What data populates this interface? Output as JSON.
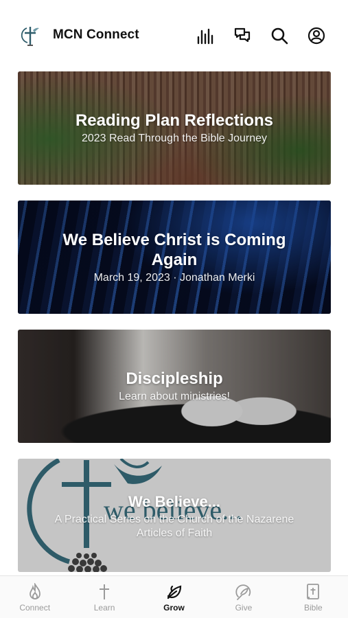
{
  "app": {
    "title": "MCN Connect"
  },
  "header_icons": [
    "bar-chart-icon",
    "chat-bubbles-icon",
    "search-icon",
    "profile-icon"
  ],
  "cards": [
    {
      "title": "Reading Plan Reflections",
      "subtitle": "2023 Read Through the Bible Journey"
    },
    {
      "title": "We Believe Christ is Coming Again",
      "subtitle": "March 19, 2023 · Jonathan Merki"
    },
    {
      "title": "Discipleship",
      "subtitle": "Learn about ministries!"
    },
    {
      "title": "We Believe...",
      "subtitle": "A Practical Series on the Church of the Nazarene Articles of Faith",
      "art_text": "we believe..."
    }
  ],
  "tabs": [
    {
      "label": "Connect",
      "icon": "flame-icon",
      "active": false
    },
    {
      "label": "Learn",
      "icon": "cross-icon",
      "active": false
    },
    {
      "label": "Grow",
      "icon": "leaf-icon",
      "active": true
    },
    {
      "label": "Give",
      "icon": "give-icon",
      "active": false
    },
    {
      "label": "Bible",
      "icon": "bible-icon",
      "active": false
    }
  ],
  "colors": {
    "accent": "#111111",
    "inactive_tab": "#9a9a9a",
    "tabbar_bg": "#fafafa",
    "logo_teal": "#2f5d6b"
  }
}
